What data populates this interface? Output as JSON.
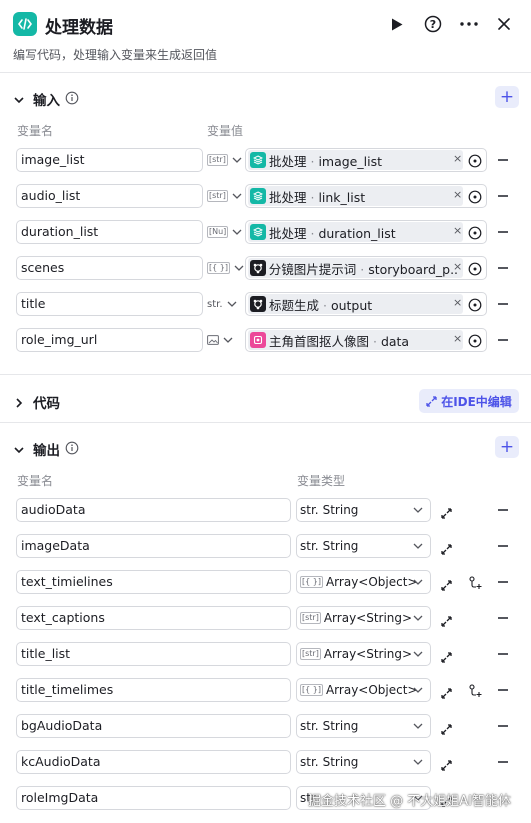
{
  "header": {
    "title": "处理数据",
    "description": "编写代码，处理输入变量来生成返回值",
    "icons": [
      "code-icon",
      "play-icon",
      "help-icon",
      "more-icon",
      "close-icon"
    ]
  },
  "input_section": {
    "title": "输入",
    "col_name": "变量名",
    "col_value": "变量值",
    "rows": [
      {
        "name": "image_list",
        "type_tag": "[str]",
        "node": "批处理",
        "field": "image_list",
        "node_icon": "batch-icon"
      },
      {
        "name": "audio_list",
        "type_tag": "[str]",
        "node": "批处理",
        "field": "link_list",
        "node_icon": "batch-icon"
      },
      {
        "name": "duration_list",
        "type_tag": "[Nu]",
        "node": "批处理",
        "field": "duration_list",
        "node_icon": "batch-icon"
      },
      {
        "name": "scenes",
        "type_tag": "[{ }]",
        "node": "分镜图片提示词",
        "field": "storyboard_p...",
        "node_icon": "llm-icon"
      },
      {
        "name": "title",
        "type_tag": "str.",
        "node": "标题生成",
        "field": "output",
        "node_icon": "llm-icon"
      },
      {
        "name": "role_img_url",
        "type_tag": "image",
        "node": "主角首图抠人像图",
        "field": "data",
        "node_icon": "plugin-icon"
      }
    ]
  },
  "code_section": {
    "title": "代码",
    "ide_button": "在IDE中编辑"
  },
  "output_section": {
    "title": "输出",
    "col_name": "变量名",
    "col_type": "变量类型",
    "rows": [
      {
        "name": "audioData",
        "type_prefix": "str.",
        "type": "String",
        "child": false
      },
      {
        "name": "imageData",
        "type_prefix": "str.",
        "type": "String",
        "child": false
      },
      {
        "name": "text_timielines",
        "type_prefix": "[{ }]",
        "type": "Array<Object>",
        "child": true
      },
      {
        "name": "text_captions",
        "type_prefix": "[str]",
        "type": "Array<String>",
        "child": false
      },
      {
        "name": "title_list",
        "type_prefix": "[str]",
        "type": "Array<String>",
        "child": false
      },
      {
        "name": "title_timelimes",
        "type_prefix": "[{ }]",
        "type": "Array<Object>",
        "child": true
      },
      {
        "name": "bgAudioData",
        "type_prefix": "str.",
        "type": "String",
        "child": false
      },
      {
        "name": "kcAudioData",
        "type_prefix": "str.",
        "type": "String",
        "child": false
      },
      {
        "name": "roleImgData",
        "type_prefix": "str.",
        "type": "",
        "child": false
      }
    ]
  },
  "watermark": "掘金技术社区 @ 不大姐姐AI智能体",
  "colors": {
    "accent": "#4d53e8",
    "teal": "#14b8a6",
    "pink": "#ec4899"
  }
}
